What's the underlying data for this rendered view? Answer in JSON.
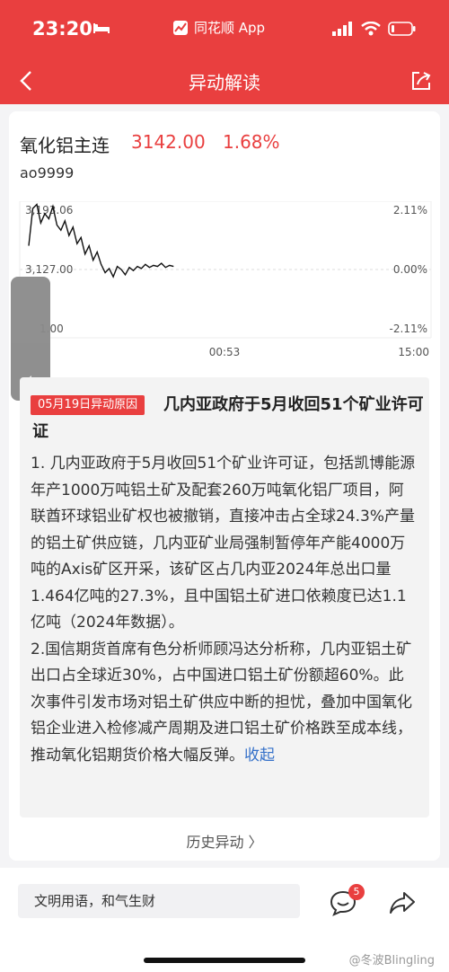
{
  "status_bar": {
    "time": "23:20",
    "app_name": "同花顺 App",
    "battery_level": 0.15
  },
  "header": {
    "title": "异动解读"
  },
  "quote": {
    "name": "氧化铝主连",
    "price": "3142.00",
    "change_pct": "1.68%",
    "code": "ao9999",
    "color_up": "#e93f3f"
  },
  "chart_data": {
    "type": "line",
    "y_left_ticks": [
      "3,193.06",
      "3,127.00",
      "3,061.00"
    ],
    "y_left_visible": [
      "3,193.06",
      "3,127.00",
      "1.00"
    ],
    "y_right_ticks": [
      "2.11%",
      "0.00%",
      "-2.11%"
    ],
    "x_ticks": [
      "",
      "00:53",
      "15:00"
    ],
    "ylim": [
      3061.0,
      3193.06
    ],
    "baseline": 3127.0,
    "x_range": [
      0,
      100
    ],
    "series": [
      {
        "x": [
          0,
          1,
          2,
          3,
          4,
          5,
          6,
          7,
          8,
          9,
          10,
          11,
          12,
          13,
          14,
          15,
          16,
          17,
          18,
          19,
          20,
          21,
          22,
          23,
          24,
          25,
          26,
          27,
          28,
          29,
          30,
          31,
          32,
          33,
          34,
          35,
          36
        ],
        "values": [
          3150,
          3186,
          3190,
          3172,
          3181,
          3176,
          3188,
          3170,
          3165,
          3174,
          3160,
          3168,
          3152,
          3158,
          3142,
          3150,
          3136,
          3144,
          3132,
          3124,
          3128,
          3120,
          3130,
          3127,
          3122,
          3129,
          3126,
          3130,
          3128,
          3132,
          3129,
          3131,
          3130,
          3133,
          3129,
          3131,
          3130
        ]
      }
    ]
  },
  "reason": {
    "tag": "05月19日异动原因",
    "title": "几内亚政府于5月收回51个矿业许可证",
    "paragraphs": [
      "1. 几内亚政府于5月收回51个矿业许可证，包括凯博能源年产1000万吨铝土矿及配套260万吨氧化铝厂项目，阿联酋环球铝业矿权也被撤销，直接冲击占全球24.3%产量的铝土矿供应链，几内亚矿业局强制暂停年产能4000万吨的Axis矿区开采，该矿区占几内亚2024年总出口量1.464亿吨的27.3%，且中国铝土矿进口依赖度已达1.1亿吨（2024年数据）。",
      "2.国信期货首席有色分析师顾冯达分析称，几内亚铝土矿出口占全球近30%，占中国进口铝土矿份额超60%。此次事件引发市场对铝土矿供应中断的担忧，叠加中国氧化铝企业进入检修减产周期及进口铝土矿价格跌至成本线，推动氧化铝期货价格大幅反弹。"
    ],
    "collapse_label": "收起"
  },
  "history_link": "历史异动 〉",
  "bottom_bar": {
    "comment_placeholder": "文明用语，和气生财",
    "comment_count": "5",
    "watermark": "@冬波Blingling"
  }
}
